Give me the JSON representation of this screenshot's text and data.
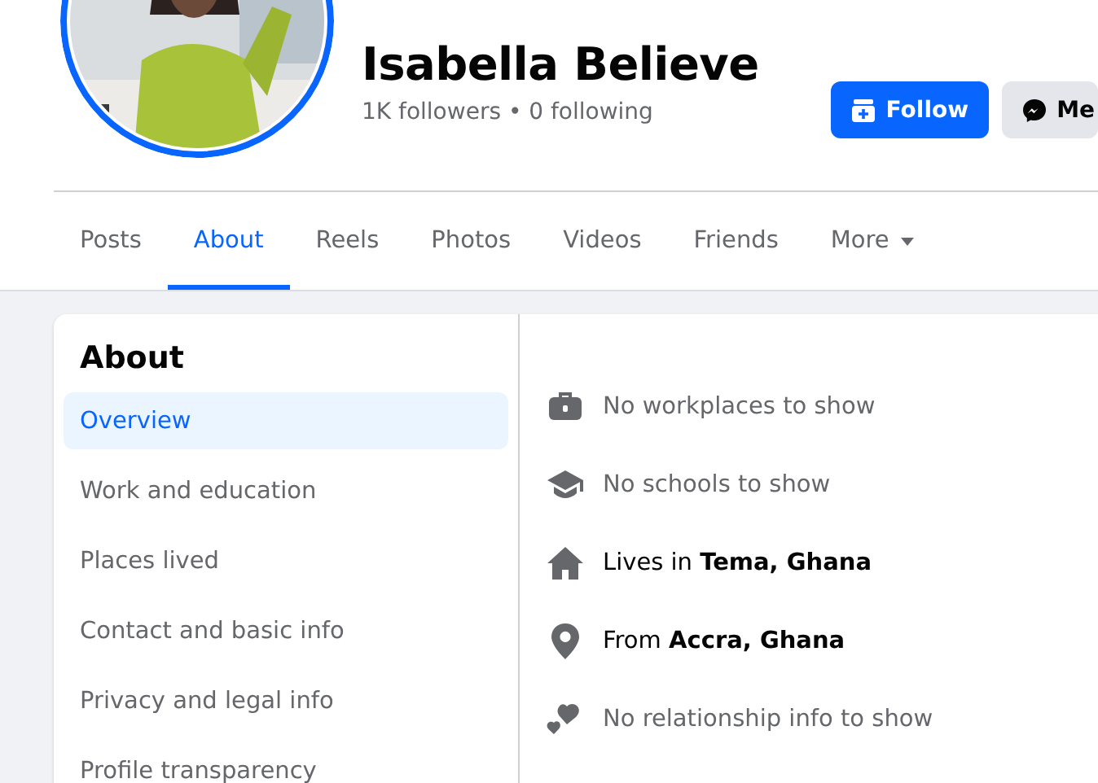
{
  "profile": {
    "name": "Isabella Believe",
    "stats": "1K followers • 0 following",
    "buttons": [
      {
        "kind": "follow",
        "label": "Follow"
      },
      {
        "kind": "message",
        "label": "Me"
      }
    ]
  },
  "tabs": [
    {
      "label": "Posts",
      "selected": false
    },
    {
      "label": "About",
      "selected": true
    },
    {
      "label": "Reels",
      "selected": false
    },
    {
      "label": "Photos",
      "selected": false
    },
    {
      "label": "Videos",
      "selected": false
    },
    {
      "label": "Friends",
      "selected": false
    },
    {
      "label": "More",
      "selected": false,
      "dropdown": true
    }
  ],
  "about": {
    "title": "About",
    "sidebar": [
      {
        "label": "Overview",
        "selected": true
      },
      {
        "label": "Work and education",
        "selected": false
      },
      {
        "label": "Places lived",
        "selected": false
      },
      {
        "label": "Contact and basic info",
        "selected": false
      },
      {
        "label": "Privacy and legal info",
        "selected": false
      },
      {
        "label": "Profile transparency",
        "selected": false
      }
    ],
    "details": [
      {
        "kind": "work",
        "text": "No workplaces to show",
        "empty": true
      },
      {
        "kind": "school",
        "text": "No schools to show",
        "empty": true
      },
      {
        "kind": "home",
        "text": "Lives in **Tema, Ghana**",
        "empty": false
      },
      {
        "kind": "hometown",
        "text": "From **Accra, Ghana**",
        "empty": false
      },
      {
        "kind": "relationship",
        "text": "No relationship info to show",
        "empty": true
      }
    ]
  }
}
